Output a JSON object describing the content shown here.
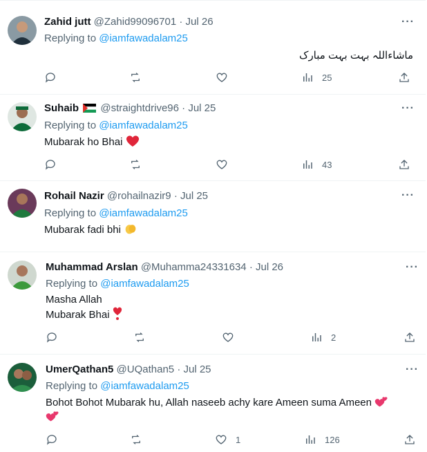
{
  "replies": [
    {
      "name": "Zahid jutt",
      "handle": "@Zahid99096701",
      "date": "· Jul 26",
      "replying_label": "Replying to",
      "replying_handle": "@iamfawadalam25",
      "text": "ماشاءاللہ بہت بہت مبارک",
      "views": "25",
      "likes": ""
    },
    {
      "name": "Suhaib",
      "handle": "@straightdrive96",
      "date": "· Jul 25",
      "replying_label": "Replying to",
      "replying_handle": "@iamfawadalam25",
      "text": "Mubarak ho Bhai",
      "views": "43",
      "likes": ""
    },
    {
      "name": "Rohail Nazir",
      "handle": "@rohailnazir9",
      "date": "· Jul 25",
      "replying_label": "Replying to",
      "replying_handle": "@iamfawadalam25",
      "text": "Mubarak fadi bhi"
    },
    {
      "name": "Muhammad Arslan",
      "handle": "@Muhamma24331634",
      "date": "· Jul 26",
      "replying_label": "Replying to",
      "replying_handle": "@iamfawadalam25",
      "text_line1": "Masha Allah",
      "text_line2": "Mubarak Bhai",
      "views": "2",
      "likes": ""
    },
    {
      "name": "UmerQathan5",
      "handle": "@UQathan5",
      "date": "· Jul 25",
      "replying_label": "Replying to",
      "replying_handle": "@iamfawadalam25",
      "text": "Bohot Bohot Mubarak hu, Allah naseeb achy kare Ameen suma Ameen",
      "views": "126",
      "likes": "1"
    }
  ],
  "more_label": "···",
  "icons": {
    "reply": "reply-icon",
    "retweet": "retweet-icon",
    "like": "heart-icon",
    "views": "views-icon",
    "share": "share-icon"
  }
}
